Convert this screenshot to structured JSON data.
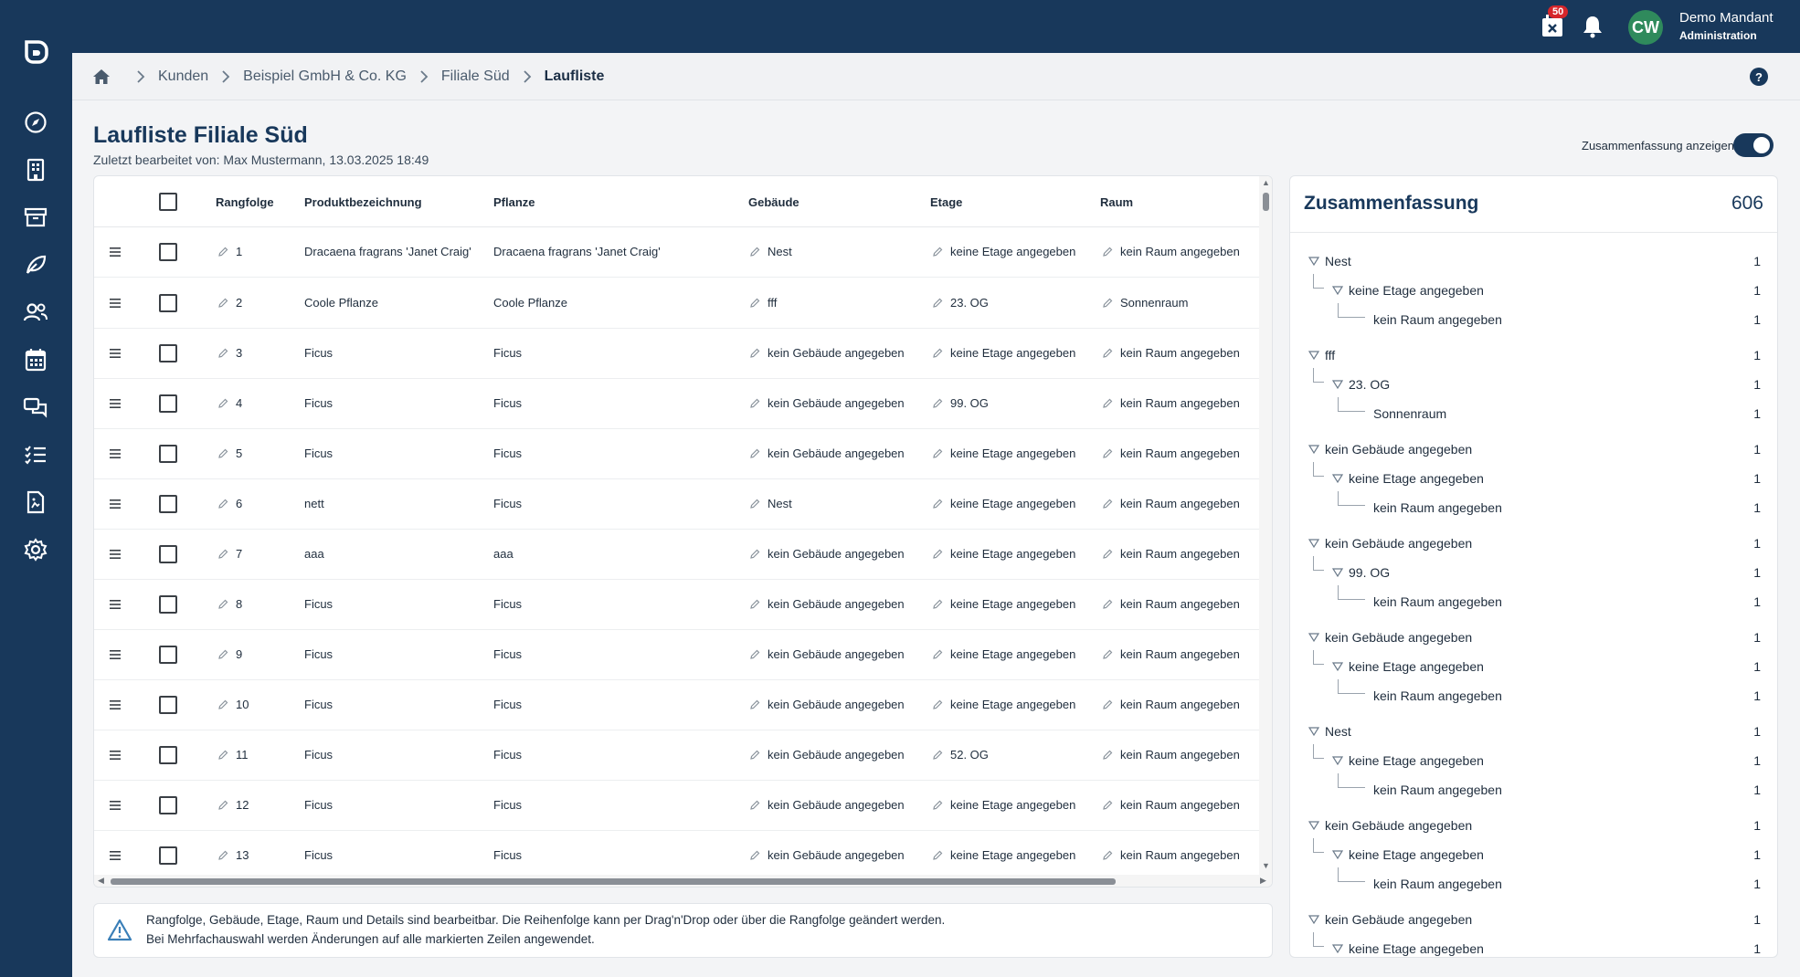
{
  "user": {
    "initials": "CW",
    "name": "Demo Mandant",
    "role": "Administration",
    "calendar_badge": "50"
  },
  "breadcrumb": [
    "Kunden",
    "Beispiel GmbH & Co. KG",
    "Filiale Süd",
    "Laufliste"
  ],
  "page": {
    "title": "Laufliste Filiale Süd",
    "subtitle": "Zuletzt bearbeitet von: Max Mustermann, 13.03.2025 18:49",
    "toggle_label": "Zusammenfassung anzeigen"
  },
  "table": {
    "headers": {
      "rangfolge": "Rangfolge",
      "produkt": "Produktbezeichnung",
      "pflanze": "Pflanze",
      "gebaeude": "Gebäude",
      "etage": "Etage",
      "raum": "Raum"
    },
    "rows": [
      {
        "rang": "1",
        "produkt": "Dracaena fragrans 'Janet Craig'",
        "pflanze": "Dracaena fragrans 'Janet Craig'",
        "gebaeude": "Nest",
        "etage": "keine Etage angegeben",
        "raum": "kein Raum angegeben"
      },
      {
        "rang": "2",
        "produkt": "Coole Pflanze",
        "pflanze": "Coole Pflanze",
        "gebaeude": "fff",
        "etage": "23. OG",
        "raum": "Sonnenraum"
      },
      {
        "rang": "3",
        "produkt": "Ficus",
        "pflanze": "Ficus",
        "gebaeude": "kein Gebäude angegeben",
        "etage": "keine Etage angegeben",
        "raum": "kein Raum angegeben"
      },
      {
        "rang": "4",
        "produkt": "Ficus",
        "pflanze": "Ficus",
        "gebaeude": "kein Gebäude angegeben",
        "etage": "99. OG",
        "raum": "kein Raum angegeben"
      },
      {
        "rang": "5",
        "produkt": "Ficus",
        "pflanze": "Ficus",
        "gebaeude": "kein Gebäude angegeben",
        "etage": "keine Etage angegeben",
        "raum": "kein Raum angegeben"
      },
      {
        "rang": "6",
        "produkt": "nett",
        "pflanze": "Ficus",
        "gebaeude": "Nest",
        "etage": "keine Etage angegeben",
        "raum": "kein Raum angegeben"
      },
      {
        "rang": "7",
        "produkt": "aaa",
        "pflanze": "aaa",
        "gebaeude": "kein Gebäude angegeben",
        "etage": "keine Etage angegeben",
        "raum": "kein Raum angegeben"
      },
      {
        "rang": "8",
        "produkt": "Ficus",
        "pflanze": "Ficus",
        "gebaeude": "kein Gebäude angegeben",
        "etage": "keine Etage angegeben",
        "raum": "kein Raum angegeben"
      },
      {
        "rang": "9",
        "produkt": "Ficus",
        "pflanze": "Ficus",
        "gebaeude": "kein Gebäude angegeben",
        "etage": "keine Etage angegeben",
        "raum": "kein Raum angegeben"
      },
      {
        "rang": "10",
        "produkt": "Ficus",
        "pflanze": "Ficus",
        "gebaeude": "kein Gebäude angegeben",
        "etage": "keine Etage angegeben",
        "raum": "kein Raum angegeben"
      },
      {
        "rang": "11",
        "produkt": "Ficus",
        "pflanze": "Ficus",
        "gebaeude": "kein Gebäude angegeben",
        "etage": "52. OG",
        "raum": "kein Raum angegeben"
      },
      {
        "rang": "12",
        "produkt": "Ficus",
        "pflanze": "Ficus",
        "gebaeude": "kein Gebäude angegeben",
        "etage": "keine Etage angegeben",
        "raum": "kein Raum angegeben"
      },
      {
        "rang": "13",
        "produkt": "Ficus",
        "pflanze": "Ficus",
        "gebaeude": "kein Gebäude angegeben",
        "etage": "keine Etage angegeben",
        "raum": "kein Raum angegeben"
      }
    ]
  },
  "info": {
    "line1": "Rangfolge, Gebäude, Etage, Raum und Details sind bearbeitbar. Die Reihenfolge kann per Drag'n'Drop oder über die Rangfolge geändert werden.",
    "line2": "Bei Mehrfachauswahl werden Änderungen auf alle markierten Zeilen angewendet."
  },
  "summary": {
    "title": "Zusammenfassung",
    "count": "606",
    "items": [
      {
        "level": 0,
        "label": "Nest",
        "count": "1"
      },
      {
        "level": 1,
        "label": "keine Etage angegeben",
        "count": "1"
      },
      {
        "level": 2,
        "label": "kein Raum angegeben",
        "count": "1"
      },
      {
        "level": 0,
        "label": "fff",
        "count": "1"
      },
      {
        "level": 1,
        "label": "23. OG",
        "count": "1"
      },
      {
        "level": 2,
        "label": "Sonnenraum",
        "count": "1"
      },
      {
        "level": 0,
        "label": "kein Gebäude angegeben",
        "count": "1"
      },
      {
        "level": 1,
        "label": "keine Etage angegeben",
        "count": "1"
      },
      {
        "level": 2,
        "label": "kein Raum angegeben",
        "count": "1"
      },
      {
        "level": 0,
        "label": "kein Gebäude angegeben",
        "count": "1"
      },
      {
        "level": 1,
        "label": "99. OG",
        "count": "1"
      },
      {
        "level": 2,
        "label": "kein Raum angegeben",
        "count": "1"
      },
      {
        "level": 0,
        "label": "kein Gebäude angegeben",
        "count": "1"
      },
      {
        "level": 1,
        "label": "keine Etage angegeben",
        "count": "1"
      },
      {
        "level": 2,
        "label": "kein Raum angegeben",
        "count": "1"
      },
      {
        "level": 0,
        "label": "Nest",
        "count": "1"
      },
      {
        "level": 1,
        "label": "keine Etage angegeben",
        "count": "1"
      },
      {
        "level": 2,
        "label": "kein Raum angegeben",
        "count": "1"
      },
      {
        "level": 0,
        "label": "kein Gebäude angegeben",
        "count": "1"
      },
      {
        "level": 1,
        "label": "keine Etage angegeben",
        "count": "1"
      },
      {
        "level": 2,
        "label": "kein Raum angegeben",
        "count": "1"
      },
      {
        "level": 0,
        "label": "kein Gebäude angegeben",
        "count": "1"
      },
      {
        "level": 1,
        "label": "keine Etage angegeben",
        "count": "1"
      }
    ]
  },
  "colors": {
    "navy": "#18385b",
    "badge": "#d6262b",
    "avatar": "#2f8a5c"
  },
  "sidebar_icons": [
    "compass-icon",
    "building-icon",
    "archive-icon",
    "leaf-icon",
    "users-icon",
    "calendar-icon",
    "chat-icon",
    "checklist-icon",
    "document-icon",
    "settings-icon"
  ]
}
